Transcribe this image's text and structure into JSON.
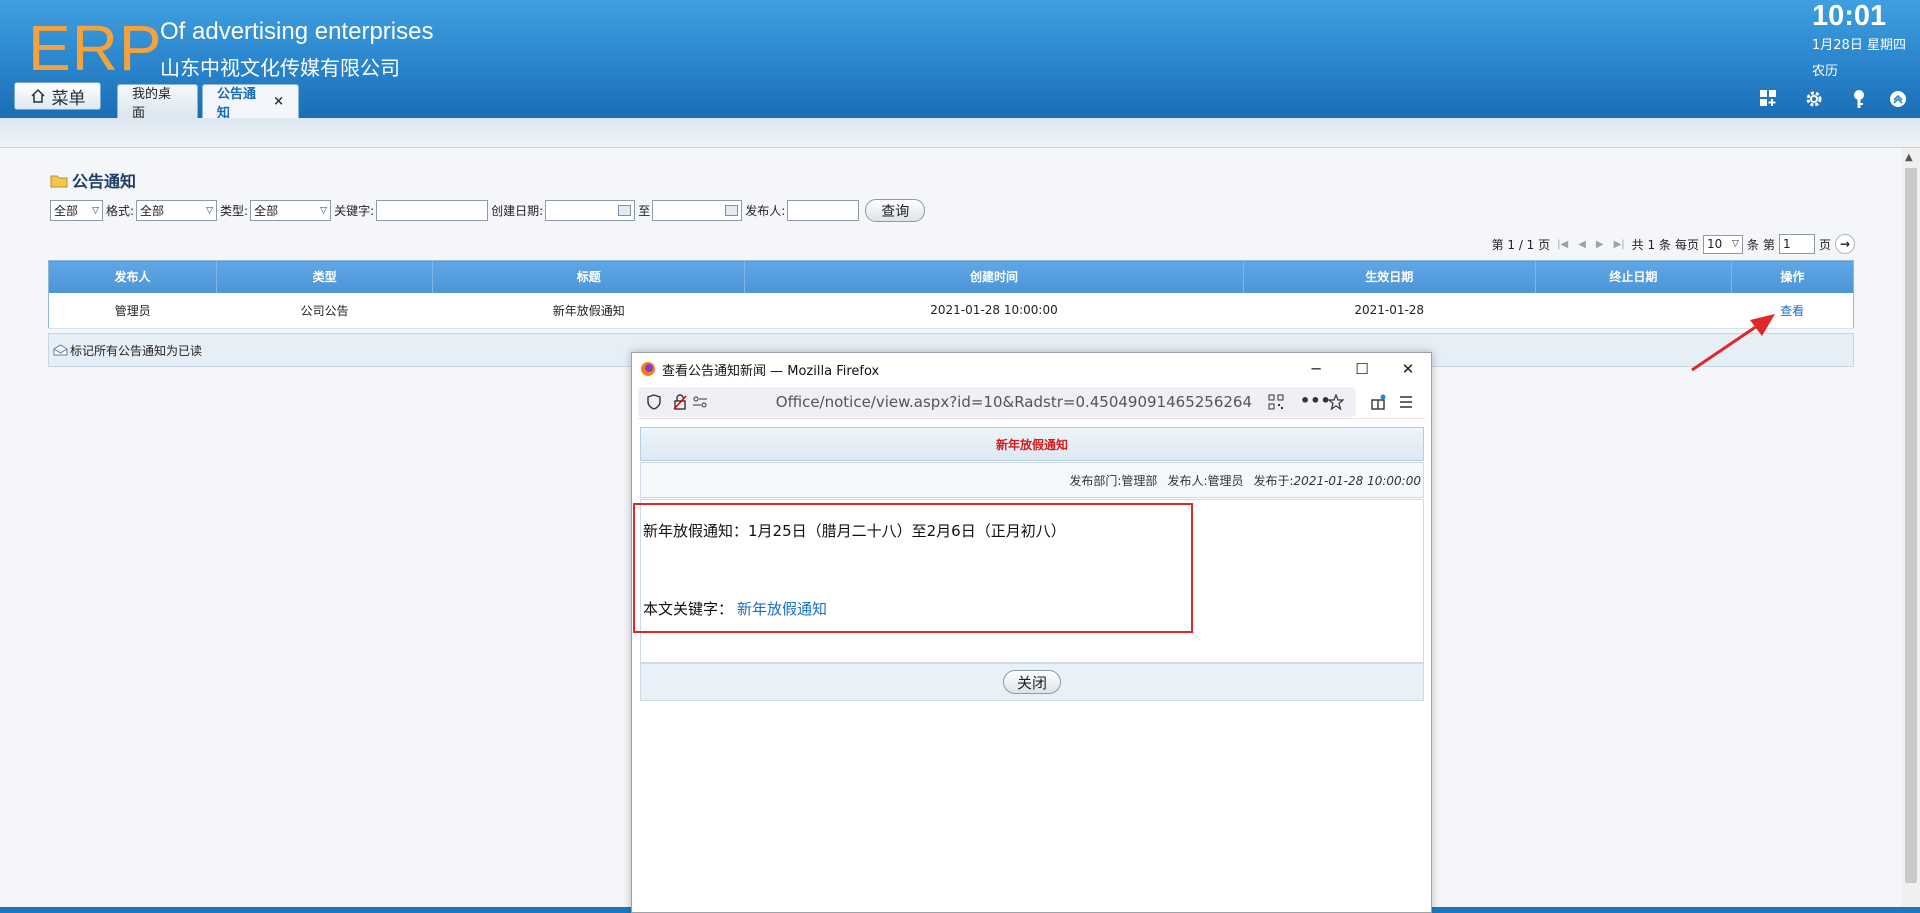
{
  "header": {
    "logo": "ERP",
    "company_en": "Of advertising enterprises",
    "company_cn": "山东中视文化传媒有限公司",
    "time": "10:01",
    "date": "1月28日 星期四",
    "lunar": "农历",
    "menu_label": "菜单",
    "tabs": [
      {
        "label": "我的桌面"
      },
      {
        "label": "公告通知",
        "close": "×"
      }
    ]
  },
  "page": {
    "title": "公告通知",
    "filters": {
      "all_label": "全部",
      "format_label": "格式:",
      "format_value": "全部",
      "type_label": "类型:",
      "type_value": "全部",
      "keyword_label": "关键字:",
      "keyword_value": "",
      "created_label": "创建日期:",
      "to_label": "至",
      "publisher_label": "发布人:",
      "query_button": "查询"
    },
    "pager": {
      "page_info": "第 1 / 1 页",
      "total": "共 1 条",
      "per_page_label": "每页",
      "per_page_value": "10",
      "unit": "条",
      "goto_prefix": "第",
      "goto_value": "1",
      "goto_suffix": "页",
      "go_arrow": "→"
    },
    "table": {
      "headers": [
        "发布人",
        "类型",
        "标题",
        "创建时间",
        "生效日期",
        "终止日期",
        "操作"
      ],
      "rows": [
        {
          "publisher": "管理员",
          "type": "公司公告",
          "title": "新年放假通知",
          "created": "2021-01-28 10:00:00",
          "effective": "2021-01-28",
          "end": "",
          "action": "查看"
        }
      ]
    },
    "mark_all_read": "标记所有公告通知为已读"
  },
  "popup": {
    "window_title": "查看公告通知新闻 — Mozilla Firefox",
    "url": "Office/notice/view.aspx?id=10&Radstr=0.45049091465256264",
    "notice_title": "新年放假通知",
    "dept_label": "发布部门:",
    "dept_value": "管理部",
    "publisher_label": "发布人:",
    "publisher_value": "管理员",
    "time_label": "发布于:",
    "time_value": "2021-01-28 10:00:00",
    "content": "新年放假通知：1月25日（腊月二十八）至2月6日（正月初八）",
    "keyword_label": "本文关键字：",
    "keyword_value": "新年放假通知",
    "close_button": "关闭"
  },
  "colors": {
    "header_blue": "#2a85cc",
    "logo_orange": "#f6a23c",
    "grid_header": "#4b94d6",
    "notice_red": "#d71a1a",
    "annotation_red": "#e02828"
  }
}
